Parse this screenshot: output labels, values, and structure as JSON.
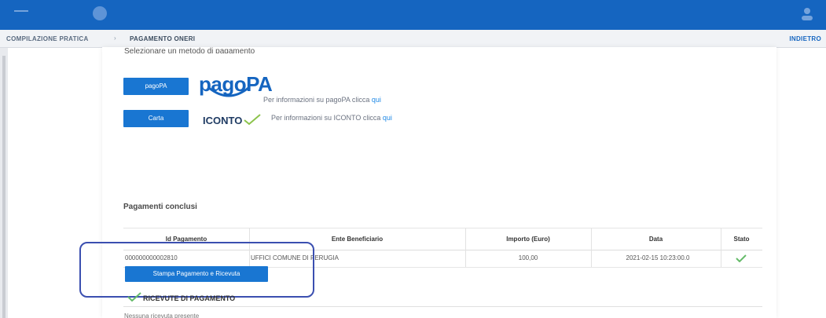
{
  "header": {
    "breadcrumb_step1": "COMPILAZIONE PRATICA",
    "breadcrumb_separator": "›",
    "breadcrumb_step2": "PAGAMENTO ONERI",
    "breadcrumb_right": "INDIETRO"
  },
  "intro_text": "Selezionare un metodo di pagamento",
  "payment_methods": {
    "pagopa_button": "pagoPA",
    "pagopa_logo": "pagoPA",
    "pagopa_info_prefix": "Per informazioni su pagoPA clicca ",
    "pagopa_info_link": "qui",
    "carta_button": "Carta",
    "iconto_logo": "ICONTO",
    "iconto_info_prefix": "Per informazioni su ICONTO clicca ",
    "iconto_info_link": "qui"
  },
  "section_title": "Pagamenti conclusi",
  "table": {
    "headers": [
      "Id Pagamento",
      "Ente Beneficiario",
      "Importo (Euro)",
      "Data",
      "Stato"
    ],
    "row": {
      "id": "000000000002810",
      "ente": "UFFICI COMUNE DI PERUGIA",
      "importo": "100,00",
      "data": "2021-02-15 10:23:00.0",
      "stato_icon": "check-icon"
    }
  },
  "stampa_button": "Stampa Pagamento e Ricevuta",
  "ricevute_label": "RICEVUTE DI PAGAMENTO",
  "bottom_text": "Nessuna ricevuta presente",
  "colors": {
    "topbar": "#1565c0",
    "button": "#1976d2",
    "highlight": "#3b4fb0",
    "check": "#66bb6a"
  }
}
